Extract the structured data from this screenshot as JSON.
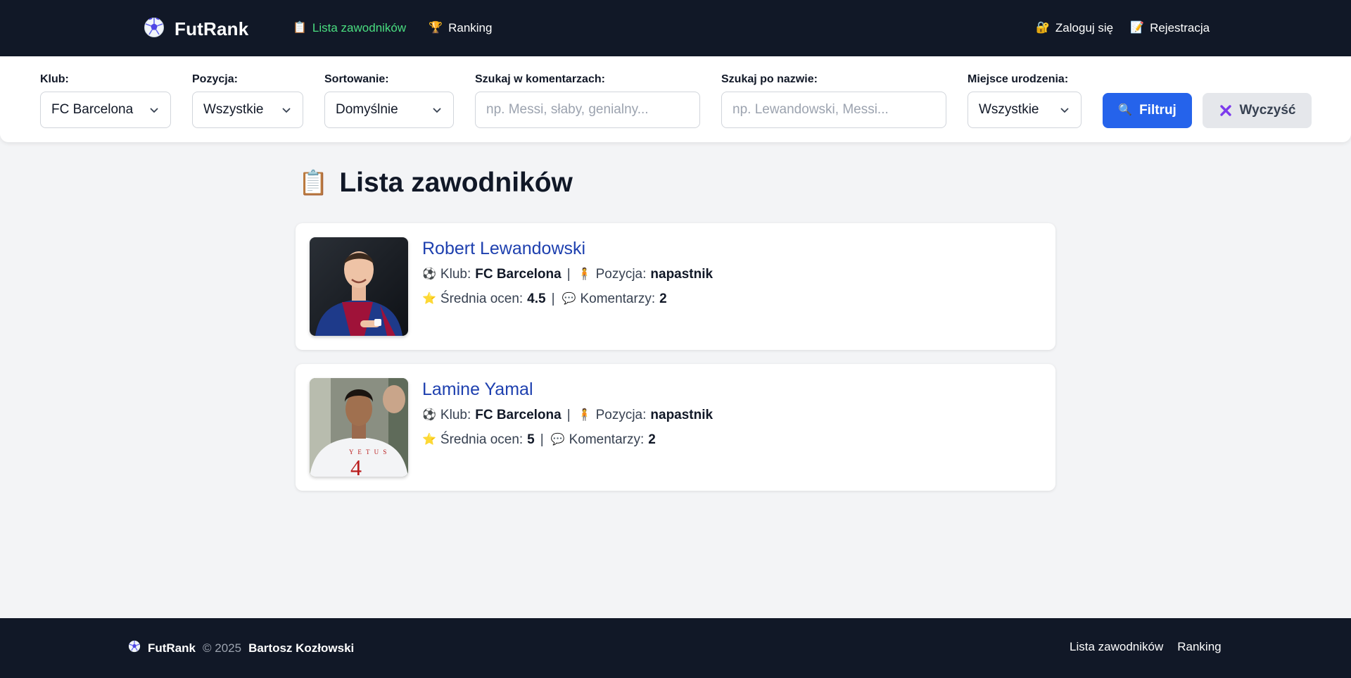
{
  "nav": {
    "brand": "FutRank",
    "brand_icon": "soccer-ball-icon",
    "links": [
      {
        "label": "Lista zawodników",
        "icon": "clipboard-icon",
        "active": true
      },
      {
        "label": "Ranking",
        "icon": "trophy-icon",
        "active": false
      }
    ],
    "login": {
      "label": "Zaloguj się",
      "icon": "lock-icon"
    },
    "register": {
      "label": "Rejestracja",
      "icon": "memo-icon"
    }
  },
  "filters": {
    "club": {
      "label": "Klub:",
      "value": "FC Barcelona"
    },
    "position": {
      "label": "Pozycja:",
      "value": "Wszystkie"
    },
    "sort": {
      "label": "Sortowanie:",
      "value": "Domyślnie"
    },
    "comments_search": {
      "label": "Szukaj w komentarzach:",
      "placeholder": "np. Messi, słaby, genialny..."
    },
    "name_search": {
      "label": "Szukaj po nazwie:",
      "placeholder": "np. Lewandowski, Messi..."
    },
    "birthplace": {
      "label": "Miejsce urodzenia:",
      "value": "Wszystkie"
    },
    "filter_button": "Filtruj",
    "clear_button": "Wyczyść"
  },
  "main": {
    "title": "Lista zawodników",
    "labels": {
      "club": "Klub:",
      "position": "Pozycja:",
      "avg_rating": "Średnia ocen:",
      "comments": "Komentarzy:"
    },
    "players": [
      {
        "name": "Robert Lewandowski",
        "club": "FC Barcelona",
        "position": "napastnik",
        "avg_rating": "4.5",
        "comments": "2"
      },
      {
        "name": "Lamine Yamal",
        "club": "FC Barcelona",
        "position": "napastnik",
        "avg_rating": "5",
        "comments": "2"
      }
    ]
  },
  "footer": {
    "brand": "FutRank",
    "copyright": "© 2025",
    "author": "Bartosz Kozłowski",
    "links": [
      "Lista zawodników",
      "Ranking"
    ]
  },
  "colors": {
    "nav_bg": "#111827",
    "active_link": "#4ade80",
    "primary": "#2563eb",
    "player_name": "#1e40af",
    "page_bg": "#f3f4f6"
  }
}
